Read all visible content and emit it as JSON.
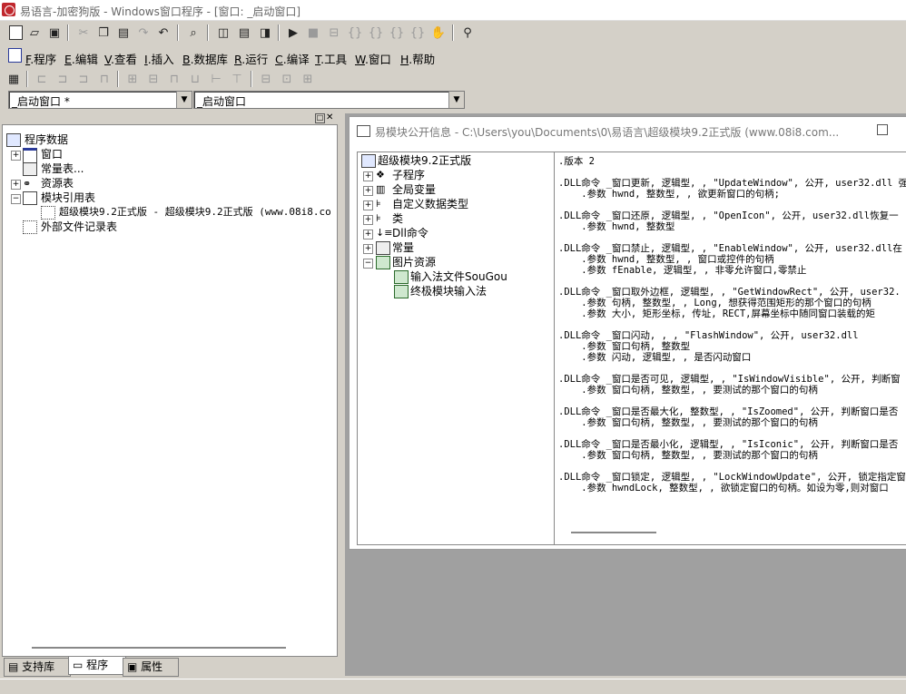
{
  "window": {
    "title": "易语言-加密狗版 - Windows窗口程序 - [窗口: _启动窗口]"
  },
  "menu": {
    "items": [
      {
        "key": "F",
        "label": ".程序"
      },
      {
        "key": "E",
        "label": ".编辑"
      },
      {
        "key": "V",
        "label": ".查看"
      },
      {
        "key": "I",
        "label": ".插入"
      },
      {
        "key": "B",
        "label": ".数据库"
      },
      {
        "key": "R",
        "label": ".运行"
      },
      {
        "key": "C",
        "label": ".编译"
      },
      {
        "key": "T",
        "label": ".工具"
      },
      {
        "key": "W",
        "label": ".窗口"
      },
      {
        "key": "H",
        "label": ".帮助"
      }
    ]
  },
  "combos": {
    "left": "_启动窗口 *",
    "right": "_启动窗口"
  },
  "left_panel": {
    "tree": {
      "root": "程序数据",
      "window": "窗口",
      "const_table": "常量表...",
      "resource_table": "资源表",
      "module_ref": "模块引用表",
      "module_item": "超级模块9.2正式版 - 超级模块9.2正式版 (www.08i8.co",
      "external_files": "外部文件记录表"
    },
    "tabs": [
      "支持库",
      "程序",
      "属性"
    ]
  },
  "dialog": {
    "title": "易模块公开信息 - C:\\Users\\you\\Documents\\0\\易语言\\超级模块9.2正式版 (www.08i8.com...",
    "tree": {
      "root": "超级模块9.2正式版",
      "items": [
        "子程序",
        "全局变量",
        "自定义数据类型",
        "类",
        "Dll命令",
        "常量",
        "图片资源"
      ],
      "children": [
        "输入法文件SouGou",
        "终极模块输入法"
      ]
    },
    "code_lines": [
      ".版本 2",
      "",
      ".DLL命令 _窗口更新, 逻辑型, , \"UpdateWindow\", 公开, user32.dll 强",
      "    .参数 hwnd, 整数型, , 欲更新窗口的句柄;",
      "",
      ".DLL命令 _窗口还原, 逻辑型, , \"OpenIcon\", 公开, user32.dll恢复一",
      "    .参数 hwnd, 整数型",
      "",
      ".DLL命令 _窗口禁止, 逻辑型, , \"EnableWindow\", 公开, user32.dll在",
      "    .参数 hwnd, 整数型, , 窗口或控件的句柄",
      "    .参数 fEnable, 逻辑型, , 非零允许窗口,零禁止",
      "",
      ".DLL命令 _窗口取外边框, 逻辑型, , \"GetWindowRect\", 公开, user32.",
      "    .参数 句柄, 整数型, , Long, 想获得范围矩形的那个窗口的句柄",
      "    .参数 大小, 矩形坐标, 传址, RECT,屏幕坐标中随同窗口装载的矩",
      "",
      ".DLL命令 _窗口闪动, , , \"FlashWindow\", 公开, user32.dll",
      "    .参数 窗口句柄, 整数型",
      "    .参数 闪动, 逻辑型, , 是否闪动窗口",
      "",
      ".DLL命令 _窗口是否可见, 逻辑型, , \"IsWindowVisible\", 公开, 判断窗",
      "    .参数 窗口句柄, 整数型, , 要测试的那个窗口的句柄",
      "",
      ".DLL命令 _窗口是否最大化, 整数型, , \"IsZoomed\", 公开, 判断窗口是否",
      "    .参数 窗口句柄, 整数型, , 要测试的那个窗口的句柄",
      "",
      ".DLL命令 _窗口是否最小化, 逻辑型, , \"IsIconic\", 公开, 判断窗口是否",
      "    .参数 窗口句柄, 整数型, , 要测试的那个窗口的句柄",
      "",
      ".DLL命令 _窗口锁定, 逻辑型, , \"LockWindowUpdate\", 公开, 锁定指定窗",
      "    .参数 hwndLock, 整数型, , 欲锁定窗口的句柄。如设为零,则对窗口"
    ]
  },
  "colors": {
    "face": "#d4d0c8",
    "mdi": "#a0a0a0",
    "app_icon": "#c0272d"
  }
}
